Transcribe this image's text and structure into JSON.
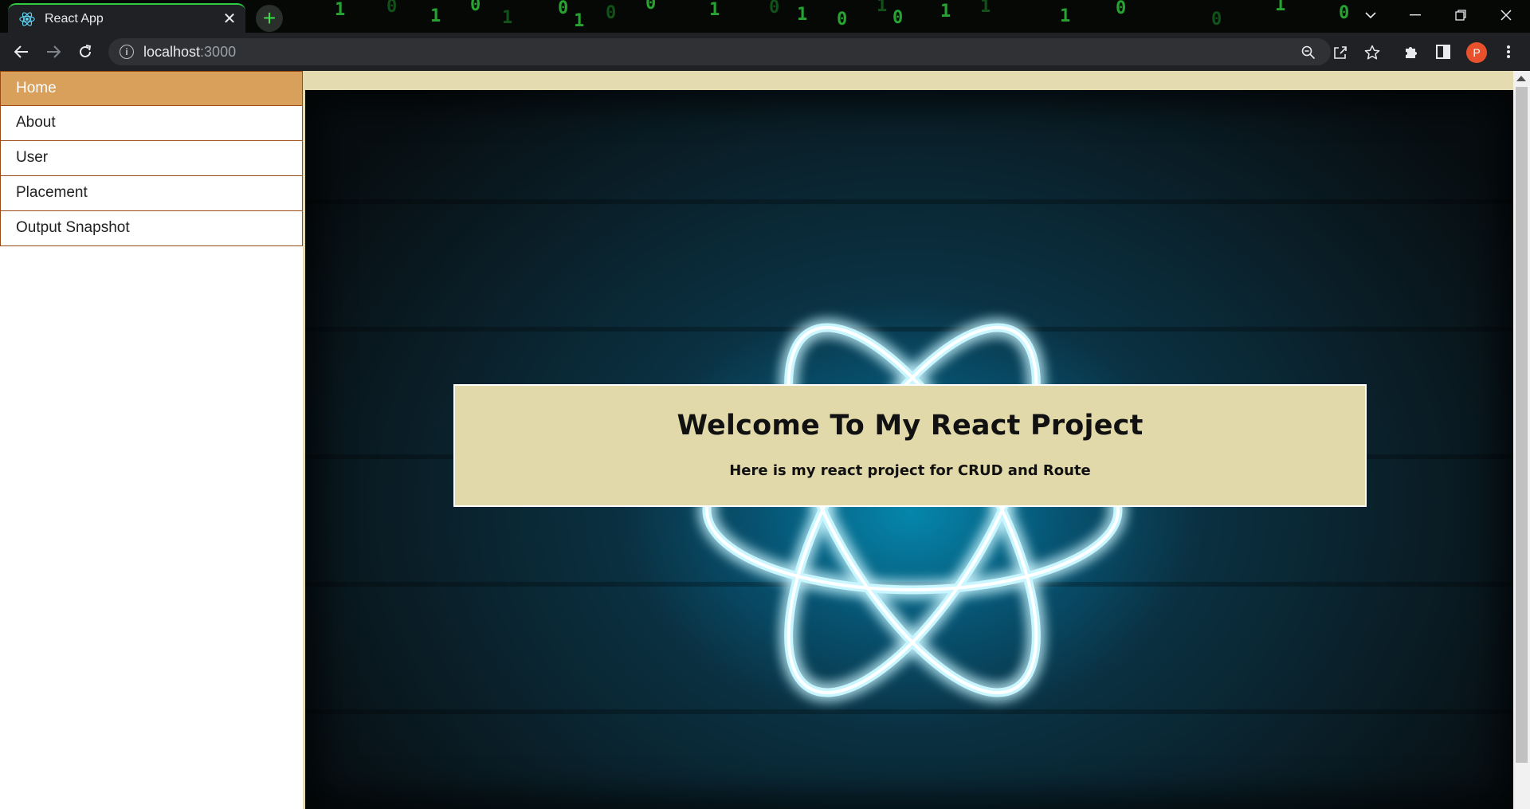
{
  "browser": {
    "tab_title": "React App",
    "url_host": "localhost",
    "url_port": ":3000",
    "profile_initial": "P",
    "accent_color": "#2ecc40"
  },
  "titlebar_matrix": [
    "1",
    "0",
    "1",
    "0",
    "1",
    "0",
    "1",
    "0",
    "0",
    "1",
    "0",
    "1",
    "0",
    "1",
    "0",
    "1",
    "1",
    "1",
    "0",
    "0",
    "1",
    "0"
  ],
  "sidebar": {
    "items": [
      {
        "label": "Home",
        "active": true
      },
      {
        "label": "About",
        "active": false
      },
      {
        "label": "User",
        "active": false
      },
      {
        "label": "Placement",
        "active": false
      },
      {
        "label": "Output Snapshot",
        "active": false
      }
    ]
  },
  "hero": {
    "title": "Welcome To My React Project",
    "subtitle": "Here is my react project for CRUD and Route"
  },
  "colors": {
    "nav_active_bg": "#d9a05b",
    "nav_border": "#9a4a12",
    "welcome_bg": "#e2d9aa"
  }
}
